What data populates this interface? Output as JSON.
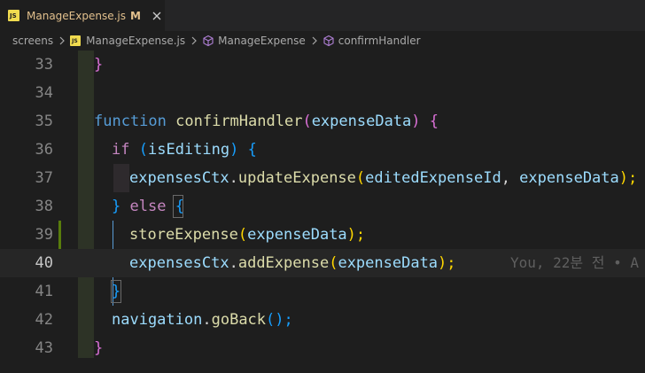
{
  "tab": {
    "icon": "JS",
    "filename": "ManageExpense.js",
    "status": "M"
  },
  "breadcrumb": {
    "folder": "screens",
    "file_icon": "JS",
    "file": "ManageExpense.js",
    "component": "ManageExpense",
    "function": "confirmHandler"
  },
  "editor": {
    "lines": [
      {
        "number": "33",
        "tokens": [
          "}"
        ]
      },
      {
        "number": "34",
        "tokens": []
      },
      {
        "number": "35",
        "tokens": [
          "function",
          " ",
          "confirmHandler",
          "(",
          "expenseData",
          ")",
          " ",
          "{"
        ]
      },
      {
        "number": "36",
        "tokens": [
          "if",
          " ",
          "(",
          "isEditing",
          ")",
          " ",
          "{"
        ]
      },
      {
        "number": "37",
        "tokens": [
          "expensesCtx",
          ".",
          "updateExpense",
          "(",
          "editedExpenseId",
          ", ",
          "expenseData",
          ");"
        ]
      },
      {
        "number": "38",
        "tokens": [
          "}",
          " ",
          "else",
          " ",
          "{"
        ]
      },
      {
        "number": "39",
        "tokens": [
          "storeExpense",
          "(",
          "expenseData",
          ");"
        ]
      },
      {
        "number": "40",
        "tokens": [
          "expensesCtx",
          ".",
          "addExpense",
          "(",
          "expenseData",
          ");"
        ]
      },
      {
        "number": "41",
        "tokens": [
          "}"
        ]
      },
      {
        "number": "42",
        "tokens": [
          "navigation",
          ".",
          "goBack",
          "(",
          ");"
        ]
      },
      {
        "number": "43",
        "tokens": [
          "}"
        ]
      }
    ],
    "blame": "You, 22분 전 • A",
    "current_line": "40"
  },
  "colors": {
    "keyword": "#569cd6",
    "control": "#c586c0",
    "function": "#dcdcaa",
    "variable": "#9cdcfe",
    "bracket_gold": "#ffd700",
    "bracket_orchid": "#da70d6",
    "bracket_blue": "#179fff",
    "modified_tab": "#e2c08d",
    "gutter_modified": "#587c0c"
  }
}
